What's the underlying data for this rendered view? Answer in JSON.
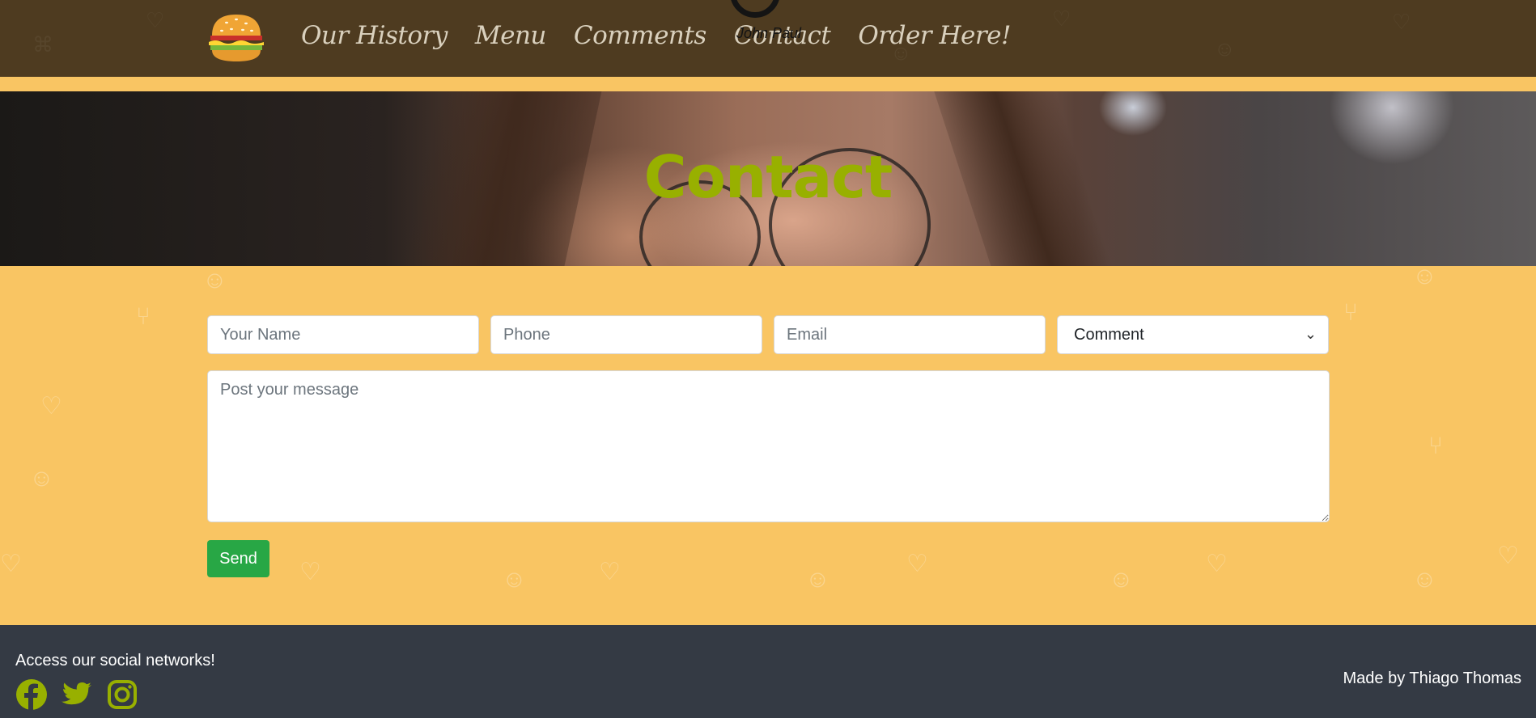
{
  "nav": {
    "logo_icon": "burger-icon",
    "links": [
      "Our History",
      "Menu",
      "Comments",
      "Contact",
      "Order Here!"
    ],
    "avatar_name": "John Paul"
  },
  "hero": {
    "title": "Contact"
  },
  "form": {
    "name_placeholder": "Your Name",
    "phone_placeholder": "Phone",
    "email_placeholder": "Email",
    "type_selected": "Comment",
    "message_placeholder": "Post your message",
    "send_label": "Send"
  },
  "footer": {
    "social_text": "Access our social networks!",
    "social_icons": [
      "facebook-icon",
      "twitter-icon",
      "instagram-icon"
    ],
    "social_color": "#98b000",
    "credit": "Made by Thiago Thomas"
  },
  "colors": {
    "nav_bg": "#4e3b20",
    "page_bg": "#f9c563",
    "accent": "#98b000",
    "button": "#28a745",
    "footer_bg": "#343a44"
  }
}
